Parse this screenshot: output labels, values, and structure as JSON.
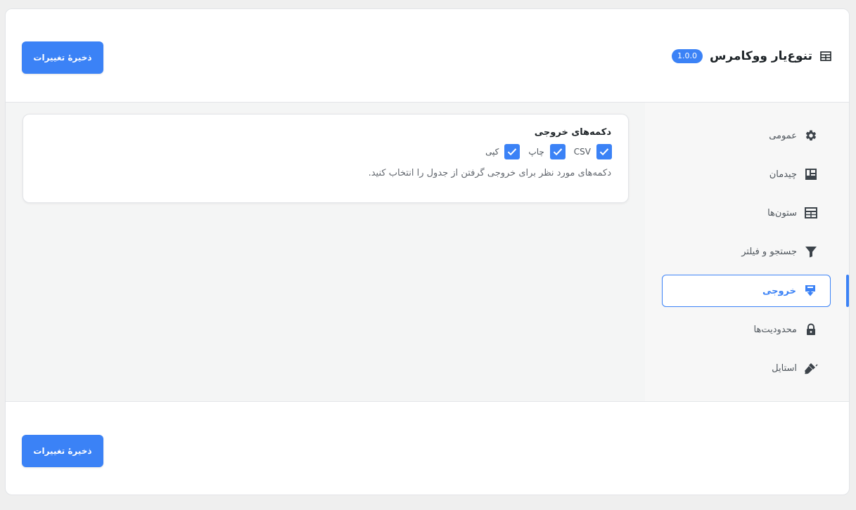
{
  "header": {
    "title": "تنوع‌یار ووکامرس",
    "version": "1.0.0",
    "title_icon": "table-icon"
  },
  "actions": {
    "save_label": "ذخیرهٔ تغییرات"
  },
  "sidebar": {
    "items": [
      {
        "label": "عمومی",
        "icon": "gear-icon",
        "active": false
      },
      {
        "label": "چیدمان",
        "icon": "layout-icon",
        "active": false
      },
      {
        "label": "ستون‌ها",
        "icon": "table-icon",
        "active": false
      },
      {
        "label": "جستجو و فیلتر",
        "icon": "filter-icon",
        "active": false
      },
      {
        "label": "خروجی",
        "icon": "export-icon",
        "active": true
      },
      {
        "label": "محدودیت‌ها",
        "icon": "lock-icon",
        "active": false
      },
      {
        "label": "استایل",
        "icon": "brush-icon",
        "active": false
      }
    ]
  },
  "export_section": {
    "title": "دکمه‌های خروجی",
    "options": [
      {
        "label": "CSV",
        "checked": true
      },
      {
        "label": "چاپ",
        "checked": true
      },
      {
        "label": "کپی",
        "checked": true
      }
    ],
    "description": "دکمه‌های مورد نظر برای خروجی گرفتن از جدول را انتخاب کنید."
  },
  "colors": {
    "accent": "#3b82f6",
    "background": "#efefef",
    "sidebar_bg": "#f7f7f7",
    "content_bg": "#f4f5f5"
  }
}
